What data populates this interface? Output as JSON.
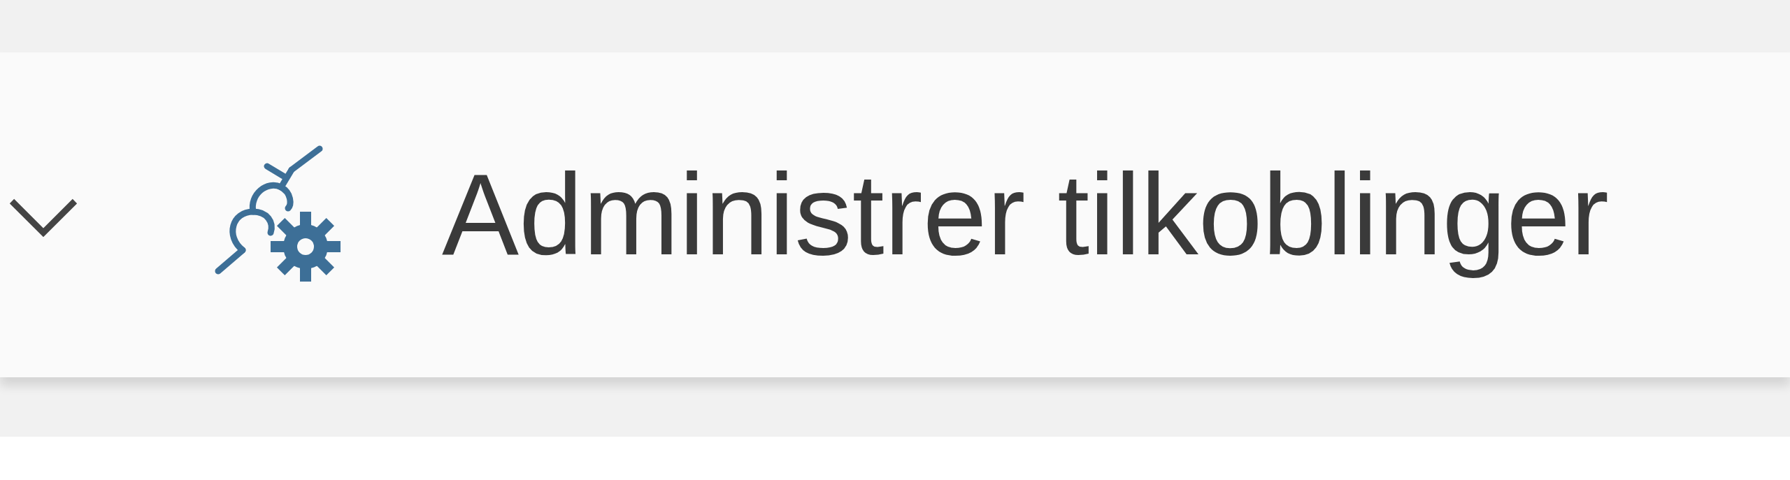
{
  "toolbar": {
    "button": {
      "label": "Administrer tilkoblinger"
    }
  }
}
